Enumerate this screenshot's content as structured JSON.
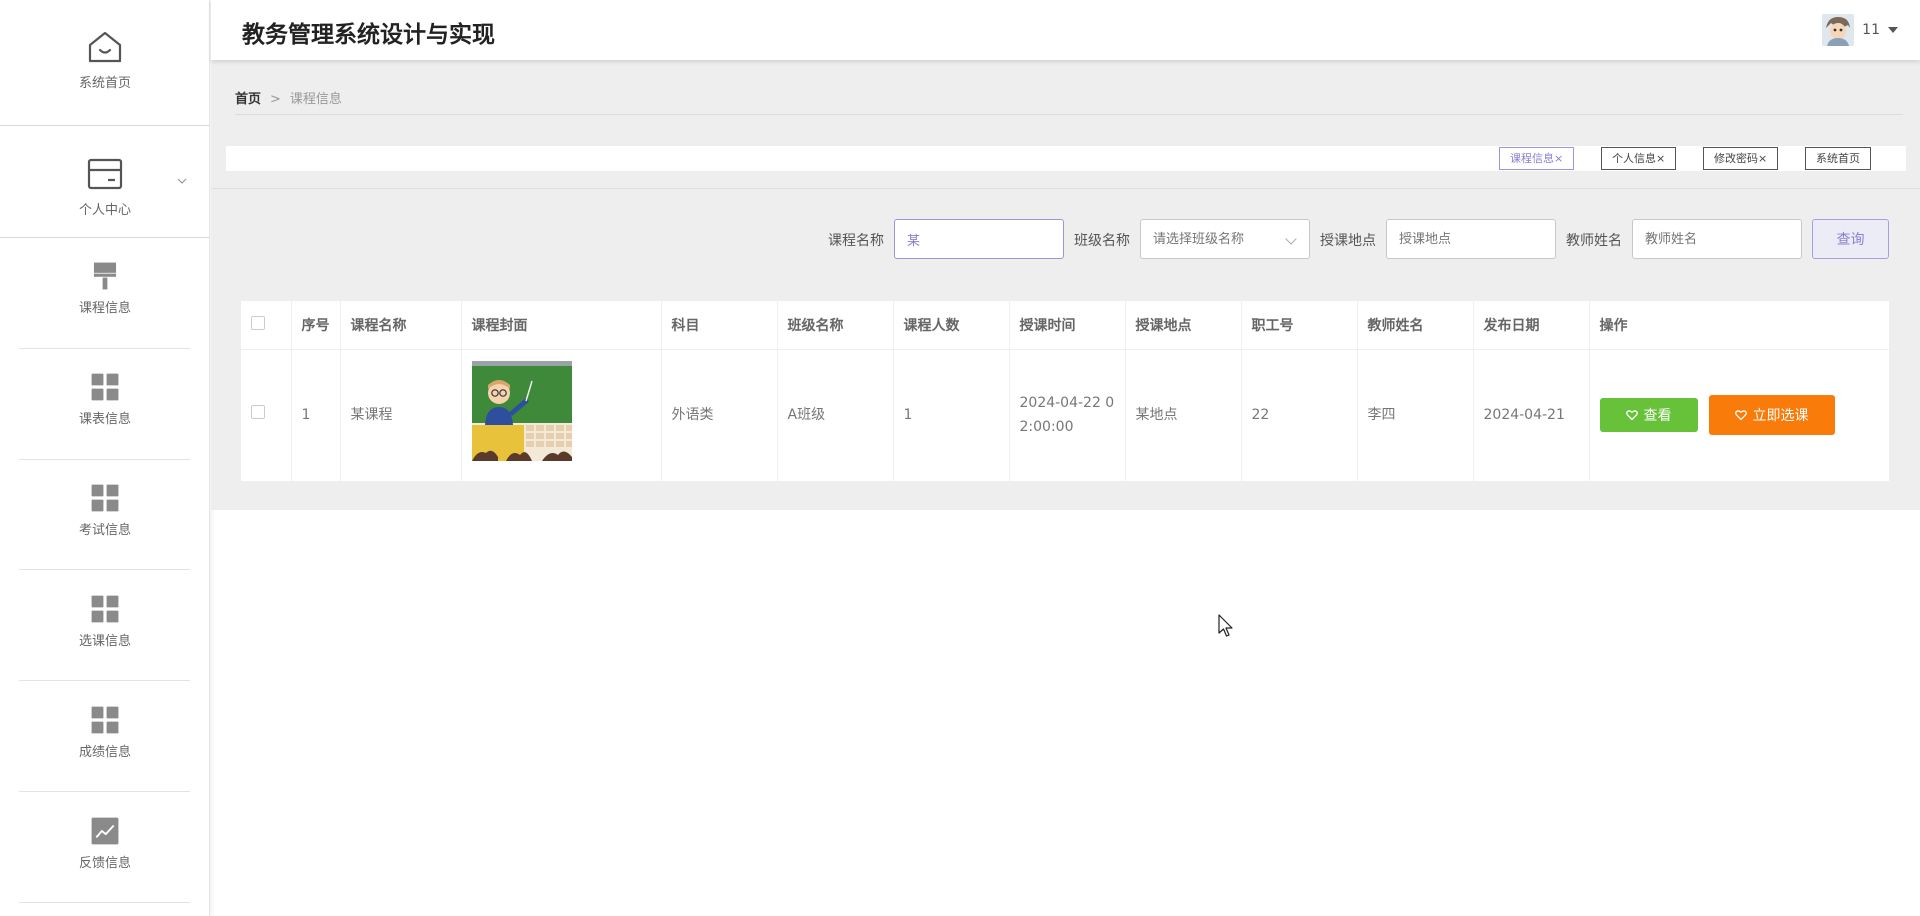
{
  "app": {
    "title": "教务管理系统设计与实现"
  },
  "user": {
    "name": "11"
  },
  "sidebar": {
    "items": [
      {
        "label": "系统首页",
        "icon": "home-icon"
      },
      {
        "label": "个人中心",
        "icon": "card-icon"
      },
      {
        "label": "课程信息",
        "icon": "brush-icon"
      },
      {
        "label": "课表信息",
        "icon": "grid-icon"
      },
      {
        "label": "考试信息",
        "icon": "grid-icon"
      },
      {
        "label": "选课信息",
        "icon": "grid-icon"
      },
      {
        "label": "成绩信息",
        "icon": "grid-icon"
      },
      {
        "label": "反馈信息",
        "icon": "chart-icon"
      }
    ]
  },
  "breadcrumb": {
    "home": "首页",
    "separator": ">",
    "current": "课程信息"
  },
  "tags": [
    {
      "label": "课程信息",
      "close": "×",
      "active": true
    },
    {
      "label": "个人信息",
      "close": "×",
      "active": false
    },
    {
      "label": "修改密码",
      "close": "×",
      "active": false
    },
    {
      "label": "系统首页",
      "close": "",
      "active": false
    }
  ],
  "search": {
    "course_name_label": "课程名称",
    "course_name_value": "某",
    "class_name_label": "班级名称",
    "class_name_placeholder": "请选择班级名称",
    "location_label": "授课地点",
    "location_placeholder": "授课地点",
    "teacher_label": "教师姓名",
    "teacher_placeholder": "教师姓名",
    "query_button": "查询"
  },
  "table": {
    "headers": [
      "序号",
      "课程名称",
      "课程封面",
      "科目",
      "班级名称",
      "课程人数",
      "授课时间",
      "授课地点",
      "职工号",
      "教师姓名",
      "发布日期",
      "操作"
    ],
    "rows": [
      {
        "index": "1",
        "course_name": "某课程",
        "subject": "外语类",
        "class_name": "A班级",
        "count": "1",
        "time_line1": "2024-04-22 0",
        "time_line2": "2:00:00",
        "location": "某地点",
        "staff_no": "22",
        "teacher": "李四",
        "publish_date": "2024-04-21",
        "view_label": "查看",
        "select_label": "立即选课"
      }
    ]
  },
  "colors": {
    "accent": "#8a7fd0",
    "view_button": "#67c23a",
    "select_button": "#f97b0a"
  }
}
